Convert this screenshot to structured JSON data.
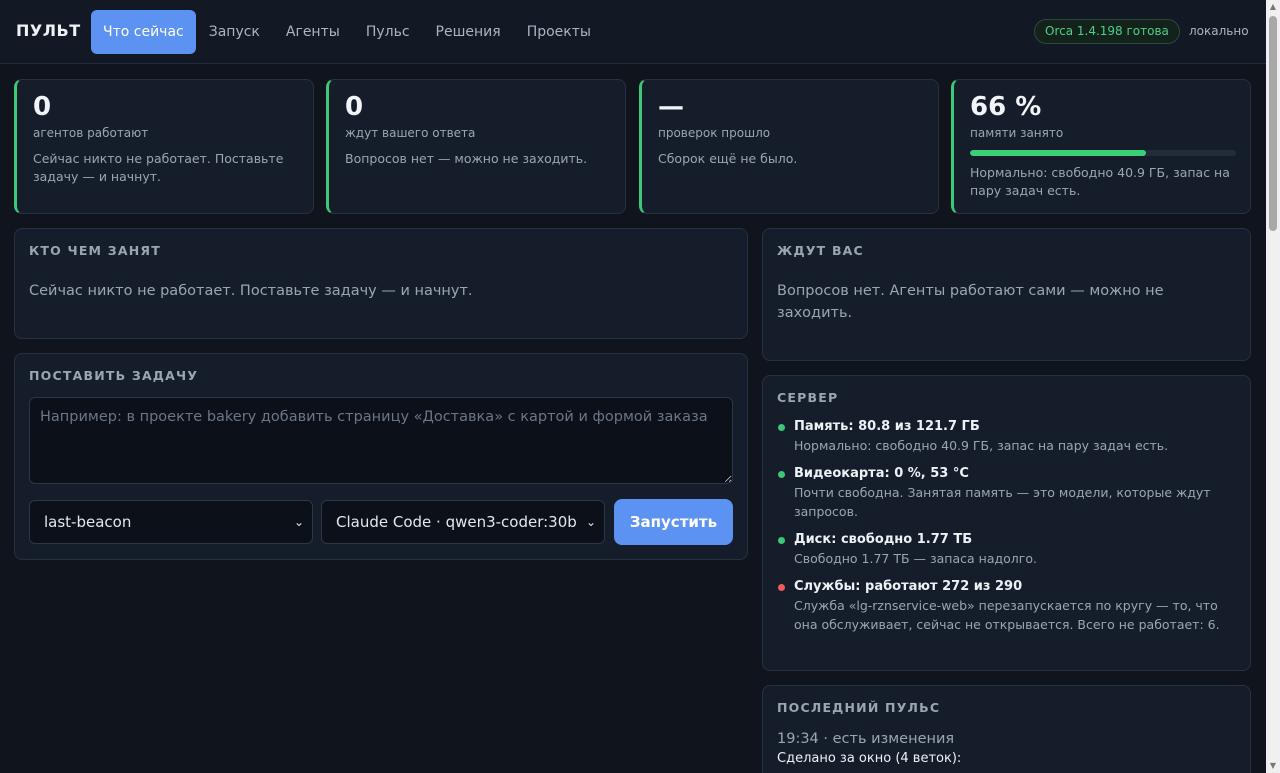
{
  "header": {
    "brand": "ПУЛЬТ",
    "nav": [
      "Что сейчас",
      "Запуск",
      "Агенты",
      "Пульс",
      "Решения",
      "Проекты"
    ],
    "active_index": 0,
    "status": "Orca 1.4.198 готова",
    "mode": "локально"
  },
  "stats": [
    {
      "value": "0",
      "label": "агентов работают",
      "desc": "Сейчас никто не работает. Поставьте задачу — и начнут."
    },
    {
      "value": "0",
      "label": "ждут вашего ответа",
      "desc": "Вопросов нет — можно не заходить."
    },
    {
      "value": "—",
      "label": "проверок прошло",
      "desc": "Сборок ещё не было."
    },
    {
      "value": "66 %",
      "label": "памяти занято",
      "progress": 0.66,
      "desc": "Нормально: свободно 40.9 ГБ, запас на пару задач есть."
    }
  ],
  "busy": {
    "title": "Кто чем занят",
    "text": "Сейчас никто не работает. Поставьте задачу — и начнут."
  },
  "task": {
    "title": "Поставить задачу",
    "placeholder": "Например: в проекте bakery добавить страницу «Доставка» с картой и формой заказа",
    "project": "last-beacon",
    "agent": "Claude Code · qwen3-coder:30b",
    "launch": "Запустить"
  },
  "waiting": {
    "title": "Ждут вас",
    "text": "Вопросов нет. Агенты работают сами — можно не заходить."
  },
  "server": {
    "title": "Сервер",
    "items": [
      {
        "head": "Память: 80.8 из 121.7 ГБ",
        "desc": "Нормально: свободно 40.9 ГБ, запас на пару задач есть.",
        "color": "#3cc77a"
      },
      {
        "head": "Видеокарта: 0 %, 53 °C",
        "desc": "Почти свободна. Занятая память — это модели, которые ждут запросов.",
        "color": "#3cc77a"
      },
      {
        "head": "Диск: свободно 1.77 ТБ",
        "desc": "Свободно 1.77 ТБ — запаса надолго.",
        "color": "#3cc77a"
      },
      {
        "head": "Службы: работают 272 из 290",
        "desc": "Служба «lg-rznservice-web» перезапускается по кругу — то, что она обслуживает, сейчас не открывается. Всего не работает: 6.",
        "color": "#ef5a5a"
      }
    ]
  },
  "pulse": {
    "title": "Последний пульс",
    "time": "19:34 · есть изменения",
    "sub": "Сделано за окно (4 веток):"
  },
  "colors": {
    "accent": "#5c93f2",
    "ok": "#3cc77a",
    "error": "#ef5a5a"
  }
}
